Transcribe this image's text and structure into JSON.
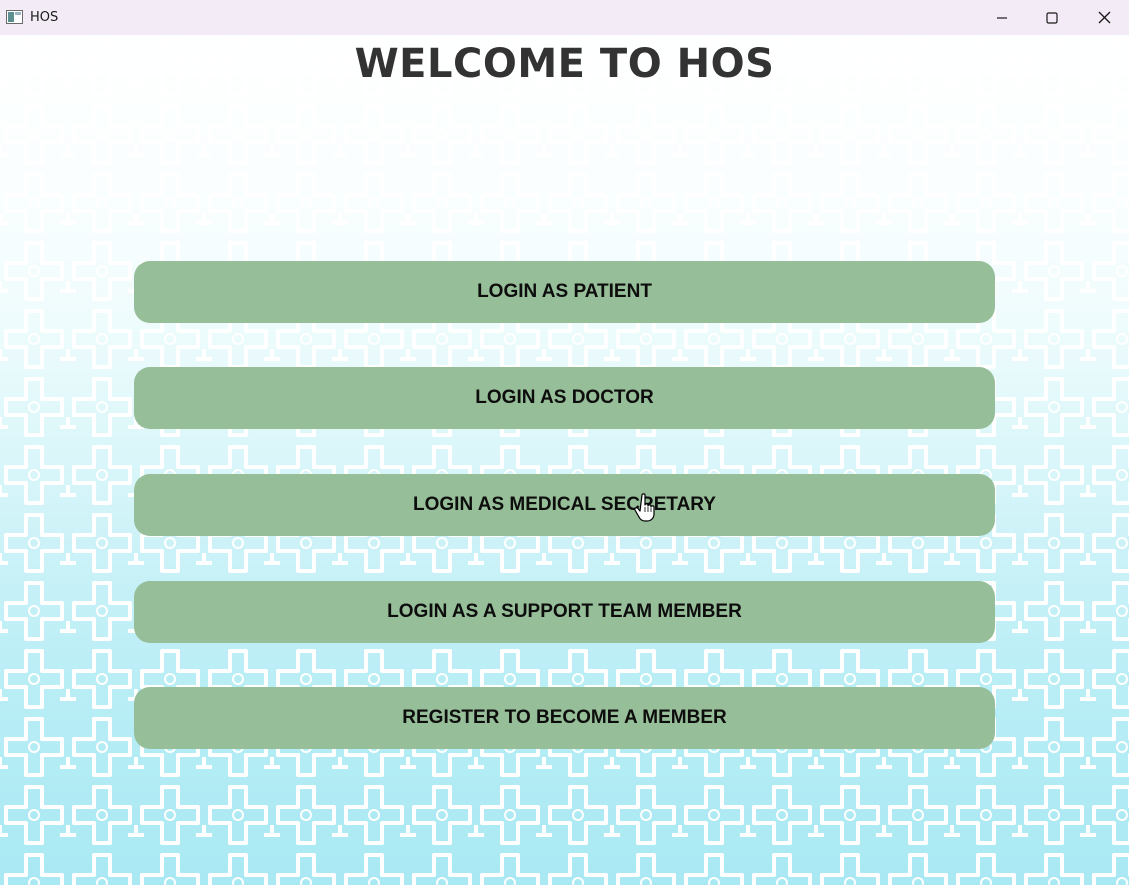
{
  "window": {
    "title": "HOS",
    "controls": {
      "minimize": "minimize-icon",
      "maximize": "maximize-icon",
      "close": "close-icon"
    }
  },
  "main": {
    "heading": "WELCOME TO HOS",
    "buttons": [
      {
        "label": "LOGIN AS PATIENT"
      },
      {
        "label": "LOGIN AS DOCTOR"
      },
      {
        "label": "LOGIN AS MEDICAL SECRETARY"
      },
      {
        "label": "LOGIN AS A SUPPORT TEAM MEMBER"
      },
      {
        "label": "REGISTER TO BECOME A MEMBER"
      }
    ]
  },
  "colors": {
    "button_bg": "#96be98",
    "heading": "#333333",
    "background_top": "#f6ffff",
    "background_bottom": "#a9e9f4"
  }
}
